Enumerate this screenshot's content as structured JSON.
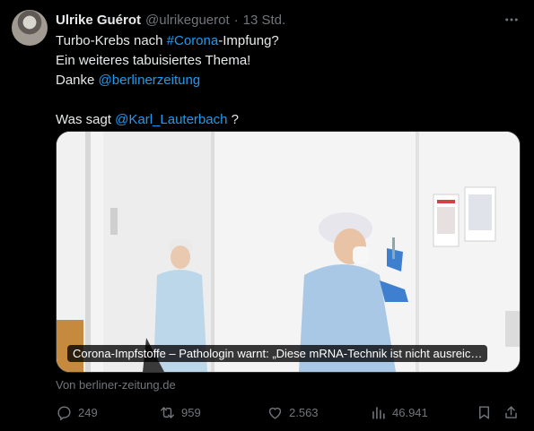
{
  "author": {
    "name": "Ulrike Guérot",
    "handle": "@ulrikeguerot",
    "separator": "·",
    "time": "13 Std."
  },
  "tweet": {
    "line1_pre": "Turbo-Krebs nach ",
    "line1_tag": "#Corona",
    "line1_post": "-Impfung?",
    "line2": "Ein weiteres tabuisiertes Thema!",
    "line3_pre": "Danke ",
    "line3_mention": "@berlinerzeitung",
    "line4_pre": "Was sagt ",
    "line4_mention": "@Karl_Lauterbach",
    "line4_post": " ?"
  },
  "card": {
    "caption": "Corona-Impfstoffe – Pathologin warnt: „Diese mRNA-Technik ist nicht ausreic…",
    "source": "Von berliner-zeitung.de"
  },
  "actions": {
    "replies": "249",
    "retweets": "959",
    "likes": "2.563",
    "views": "46.941"
  },
  "colors": {
    "background": "#000000",
    "text": "#e7e9ea",
    "muted": "#71767b",
    "link": "#1d9bf0"
  },
  "icons": [
    "more-icon",
    "reply-icon",
    "retweet-icon",
    "like-icon",
    "views-icon",
    "bookmark-icon",
    "share-icon"
  ]
}
